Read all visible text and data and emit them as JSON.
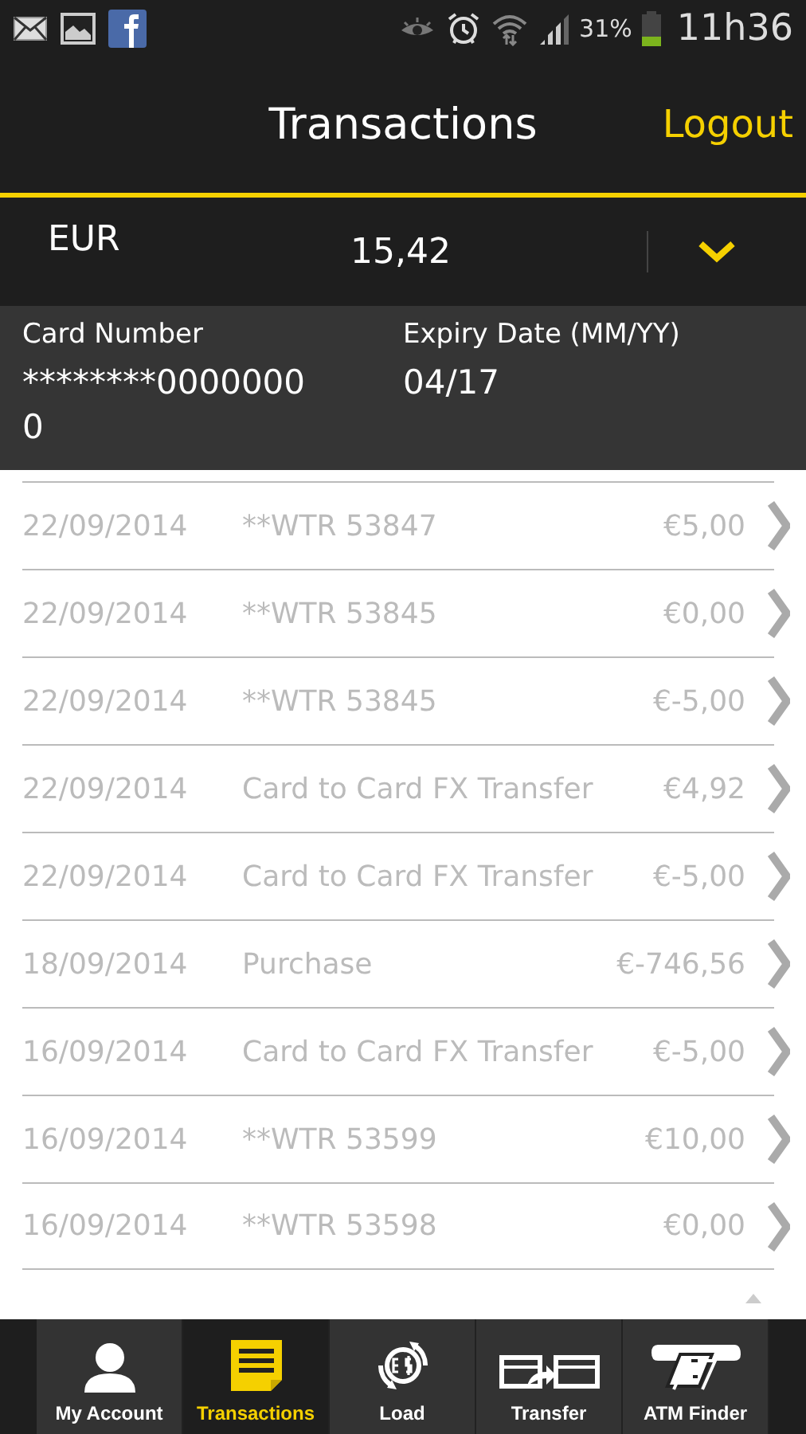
{
  "status_bar": {
    "battery": "31%",
    "time": "11h36"
  },
  "header": {
    "title": "Transactions",
    "logout": "Logout"
  },
  "balance": {
    "currency": "EUR",
    "amount": "15,42"
  },
  "card": {
    "number_label": "Card Number",
    "number": "********00000000",
    "expiry_label": "Expiry Date (MM/YY)",
    "expiry": "04/17"
  },
  "transactions": [
    {
      "date": "22/09/2014",
      "description": "**WTR 53847",
      "amount": "€5,00"
    },
    {
      "date": "22/09/2014",
      "description": "**WTR 53845",
      "amount": "€0,00"
    },
    {
      "date": "22/09/2014",
      "description": "**WTR 53845",
      "amount": "€-5,00"
    },
    {
      "date": "22/09/2014",
      "description": "Card to Card FX Transfer",
      "amount": "€4,92"
    },
    {
      "date": "22/09/2014",
      "description": "Card to Card FX Transfer",
      "amount": "€-5,00"
    },
    {
      "date": "18/09/2014",
      "description": "Purchase",
      "amount": "€-746,56"
    },
    {
      "date": "16/09/2014",
      "description": "Card to Card FX Transfer",
      "amount": "€-5,00"
    },
    {
      "date": "16/09/2014",
      "description": "**WTR 53599",
      "amount": "€10,00"
    },
    {
      "date": "16/09/2014",
      "description": "**WTR 53598",
      "amount": "€0,00"
    }
  ],
  "tabs": [
    {
      "kind": "account",
      "label": "My Account",
      "selected": false
    },
    {
      "kind": "transactions",
      "label": "Transactions",
      "selected": true
    },
    {
      "kind": "load",
      "label": "Load",
      "selected": false
    },
    {
      "kind": "transfer",
      "label": "Transfer",
      "selected": false
    },
    {
      "kind": "atm",
      "label": "ATM Finder",
      "selected": false
    }
  ]
}
